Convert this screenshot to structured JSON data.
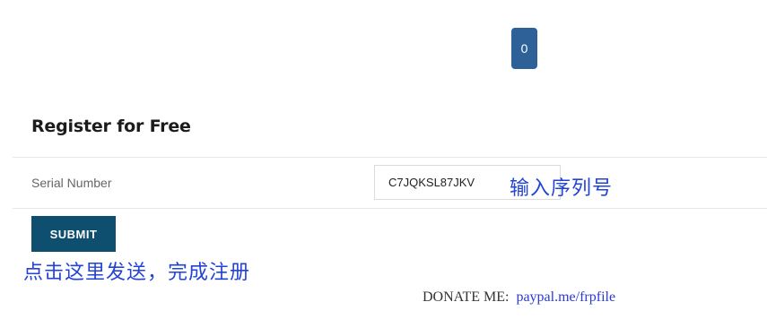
{
  "counter": {
    "value": "0"
  },
  "form": {
    "title": "Register for Free",
    "serial_label": "Serial Number",
    "serial_value": "C7JQKSL87JKV",
    "submit_label": "SUBMIT"
  },
  "annotations": {
    "serial_hint": "输入序列号",
    "submit_hint": "点击这里发送，完成注册"
  },
  "donate": {
    "label": "DONATE ME:",
    "link_text": "paypal.me/frpfile"
  },
  "colors": {
    "badge": "#2f6199",
    "submit": "#0e4e6e",
    "hint": "#2243d6",
    "link": "#2b3ad0"
  }
}
